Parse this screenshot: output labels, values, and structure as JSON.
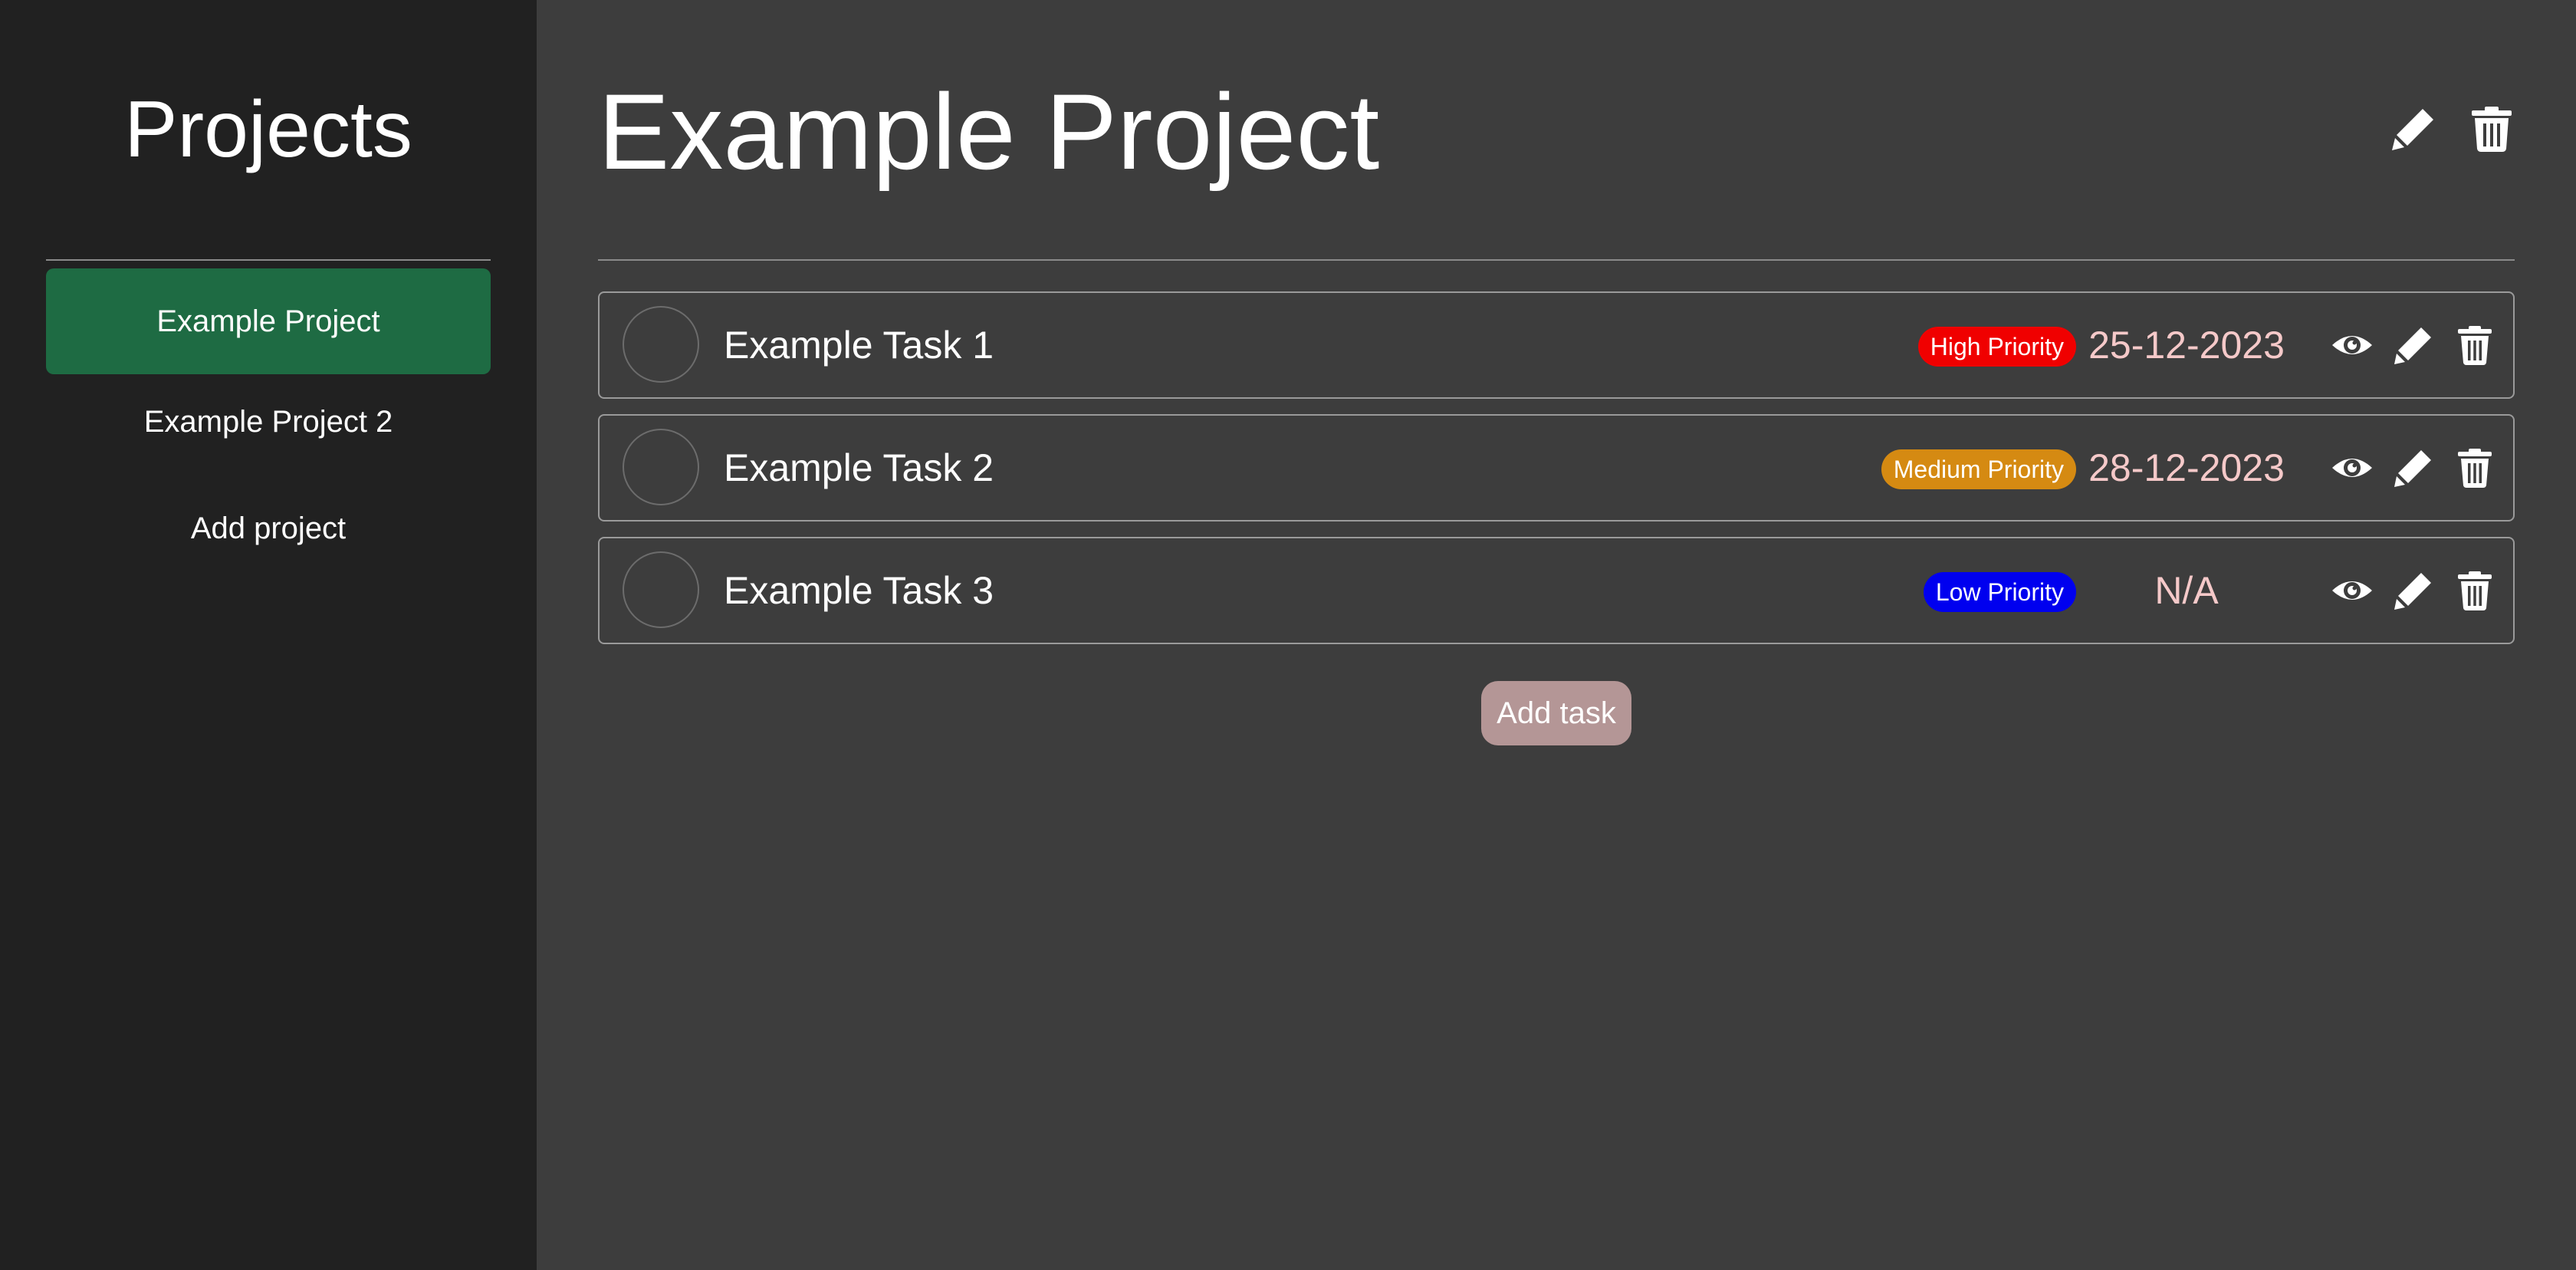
{
  "sidebar": {
    "title": "Projects",
    "items": [
      {
        "label": "Example Project",
        "active": true
      },
      {
        "label": "Example Project 2",
        "active": false
      },
      {
        "label": "Add project",
        "active": false
      }
    ]
  },
  "main": {
    "title": "Example Project",
    "header_icons": [
      "pencil-icon",
      "trash-icon"
    ],
    "tasks": [
      {
        "name": "Example Task 1",
        "priority": "High Priority",
        "priority_color": "#f00000",
        "date": "25-12-2023"
      },
      {
        "name": "Example Task 2",
        "priority": "Medium Priority",
        "priority_color": "#d58a12",
        "date": "28-12-2023"
      },
      {
        "name": "Example Task 3",
        "priority": "Low Priority",
        "priority_color": "#0000ef",
        "date": "N/A"
      }
    ],
    "add_task_label": "Add task"
  },
  "colors": {
    "sidebar_bg": "#212121",
    "main_bg": "#3d3d3d",
    "active_item": "#1e6b43",
    "date_text": "#f5c9c9",
    "add_task_bg": "#b49696"
  }
}
